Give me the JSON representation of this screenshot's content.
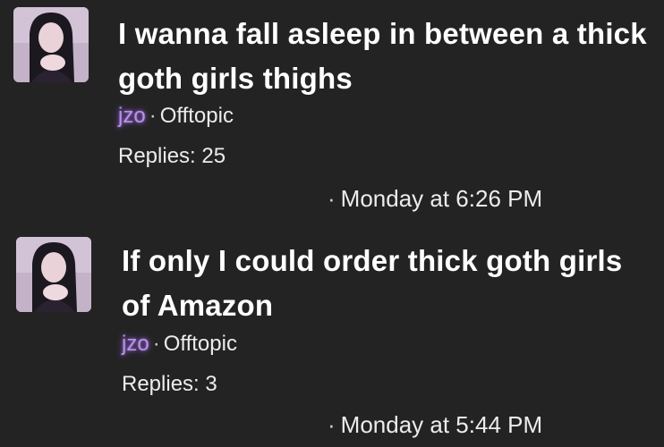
{
  "threads": [
    {
      "title": "I wanna fall asleep in between a thick goth girls thighs",
      "author": "jzo",
      "separator": "·",
      "forum": "Offtopic",
      "replies": "Replies: 25",
      "timestamp": "Monday at 6:26 PM"
    },
    {
      "title": "If only I could order thick goth girls of Amazon",
      "author": "jzo",
      "separator": "·",
      "forum": "Offtopic",
      "replies": "Replies: 3",
      "timestamp": "Monday at 5:44 PM"
    }
  ],
  "colors": {
    "background": "#232323",
    "text": "#ffffff",
    "author_glow": "#b993e6"
  }
}
